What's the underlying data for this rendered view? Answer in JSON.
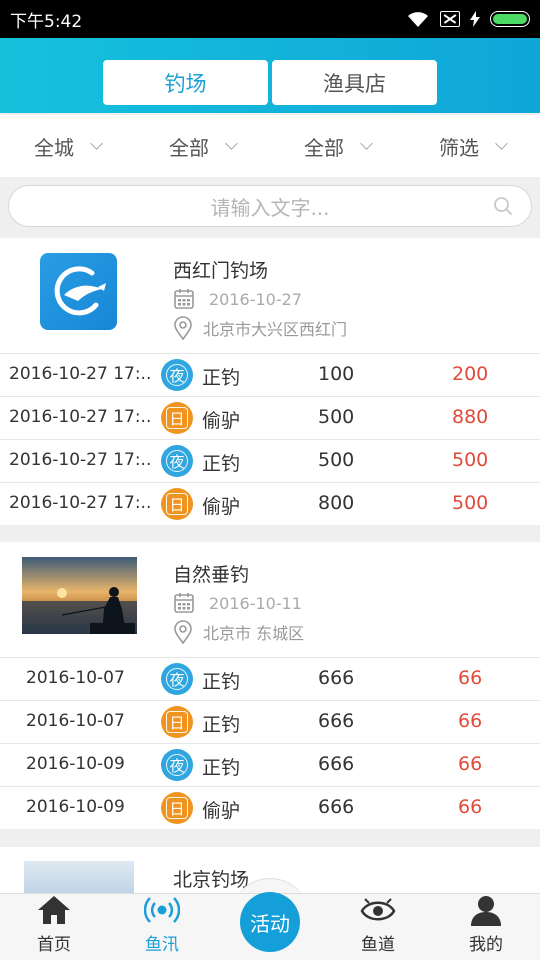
{
  "status_bar": {
    "time": "下午5:42"
  },
  "header": {
    "tabs": [
      {
        "label": "钓场",
        "active": true
      },
      {
        "label": "渔具店",
        "active": false
      }
    ]
  },
  "filters": [
    {
      "label": "全城"
    },
    {
      "label": "全部"
    },
    {
      "label": "全部"
    },
    {
      "label": "筛选"
    }
  ],
  "search": {
    "placeholder": "请输入文字..."
  },
  "venues": [
    {
      "name": "西红门钓场",
      "date": "2016-10-27",
      "location": "北京市大兴区西红门",
      "sessions": [
        {
          "time": "2016-10-27 17:..",
          "badge": "夜",
          "type": "正钓",
          "price": "100",
          "amount": "200"
        },
        {
          "time": "2016-10-27 17:..",
          "badge": "日",
          "type": "偷驴",
          "price": "500",
          "amount": "880"
        },
        {
          "time": "2016-10-27 17:..",
          "badge": "夜",
          "type": "正钓",
          "price": "500",
          "amount": "500"
        },
        {
          "time": "2016-10-27 17:..",
          "badge": "日",
          "type": "偷驴",
          "price": "800",
          "amount": "500"
        }
      ]
    },
    {
      "name": "自然垂钓",
      "date": "2016-10-11",
      "location": "北京市 东城区",
      "sessions": [
        {
          "time": "2016-10-07",
          "badge": "夜",
          "type": "正钓",
          "price": "666",
          "amount": "66"
        },
        {
          "time": "2016-10-07",
          "badge": "日",
          "type": "正钓",
          "price": "666",
          "amount": "66"
        },
        {
          "time": "2016-10-09",
          "badge": "夜",
          "type": "正钓",
          "price": "666",
          "amount": "66"
        },
        {
          "time": "2016-10-09",
          "badge": "日",
          "type": "偷驴",
          "price": "666",
          "amount": "66"
        }
      ]
    },
    {
      "name": "北京钓场"
    }
  ],
  "bottom_nav": {
    "items": [
      {
        "label": "首页",
        "icon": "home-icon"
      },
      {
        "label": "鱼汛",
        "icon": "signal-icon",
        "active": true
      },
      {
        "label": "鱼道",
        "icon": "eye-icon"
      },
      {
        "label": "我的",
        "icon": "user-icon"
      }
    ],
    "center_label": "活动"
  },
  "colors": {
    "accent": "#1a9fd6",
    "night_badge": "#2fa6e0",
    "day_badge": "#f1941f",
    "amount": "#e24a3a"
  }
}
